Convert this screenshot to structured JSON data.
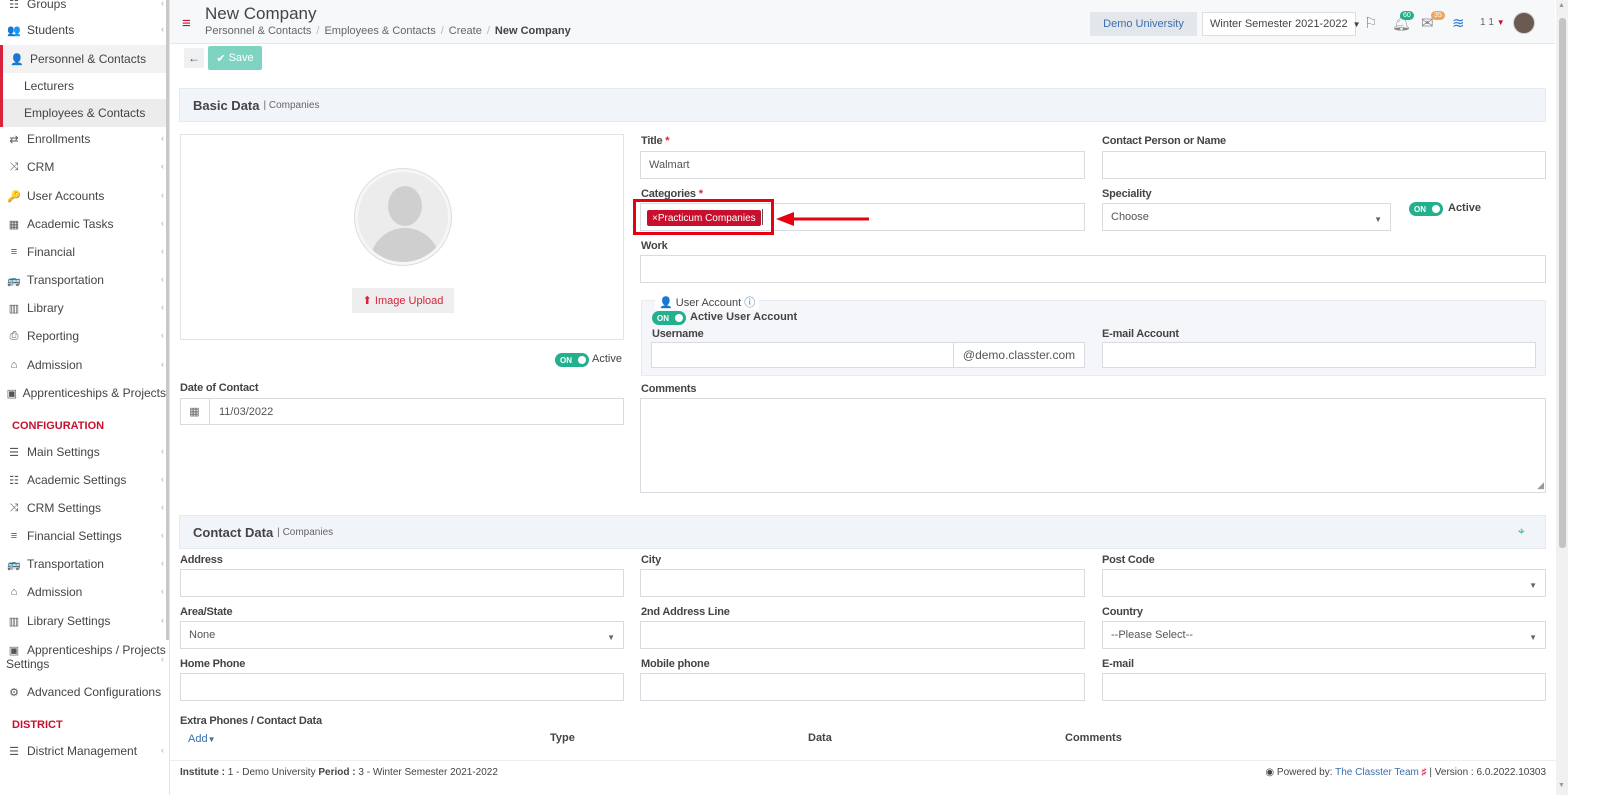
{
  "sidebar": {
    "items": [
      {
        "label": "Groups",
        "icon": "groups-icon",
        "glyph": "☷"
      },
      {
        "label": "Students",
        "icon": "students-icon",
        "glyph": "👥"
      },
      {
        "label": "Personnel & Contacts",
        "icon": "person-icon",
        "glyph": "👤"
      },
      {
        "label": "Lecturers"
      },
      {
        "label": "Employees & Contacts"
      },
      {
        "label": "Enrollments",
        "icon": "swap-icon",
        "glyph": "⇄"
      },
      {
        "label": "CRM",
        "icon": "shuffle-icon",
        "glyph": "⤨"
      },
      {
        "label": "User Accounts",
        "icon": "key-icon",
        "glyph": "🔑"
      },
      {
        "label": "Academic Tasks",
        "icon": "grid-icon",
        "glyph": "▦"
      },
      {
        "label": "Financial",
        "icon": "coins-icon",
        "glyph": "≡"
      },
      {
        "label": "Transportation",
        "icon": "bus-icon",
        "glyph": "🚌"
      },
      {
        "label": "Library",
        "icon": "books-icon",
        "glyph": "▥"
      },
      {
        "label": "Reporting",
        "icon": "print-icon",
        "glyph": "⎙"
      },
      {
        "label": "Admission",
        "icon": "bank-icon",
        "glyph": "⌂"
      },
      {
        "label": "Apprenticeships & Projects",
        "icon": "box-icon",
        "glyph": "▣"
      },
      {
        "label": "Main Settings",
        "icon": "sliders-icon",
        "glyph": "☰"
      },
      {
        "label": "Academic Settings",
        "icon": "groups-icon",
        "glyph": "☷"
      },
      {
        "label": "CRM Settings",
        "icon": "shuffle-icon",
        "glyph": "⤨"
      },
      {
        "label": "Financial Settings",
        "icon": "coins-icon",
        "glyph": "≡"
      },
      {
        "label": "Transportation",
        "icon": "bus-icon",
        "glyph": "🚌"
      },
      {
        "label": "Admission",
        "icon": "bank-icon",
        "glyph": "⌂"
      },
      {
        "label": "Library Settings",
        "icon": "books-icon",
        "glyph": "▥"
      },
      {
        "label": "Apprenticeships / Projects",
        "label2": "Settings",
        "icon": "box-icon",
        "glyph": "▣"
      },
      {
        "label": "Advanced Configurations",
        "icon": "gears-icon",
        "glyph": "⚙"
      },
      {
        "label": "District Management",
        "icon": "list-icon",
        "glyph": "☰"
      }
    ],
    "section_config": "CONFIGURATION",
    "section_district": "DISTRICT",
    "chevron": "‹"
  },
  "header": {
    "title": "New Company",
    "breadcrumb": [
      "Personnel & Contacts",
      "Employees & Contacts",
      "Create",
      "New Company"
    ],
    "breadcrumb_sep": "/",
    "institution": "Demo University",
    "semester": "Winter Semester 2021-2022",
    "notifications_count": "60",
    "messages_count": "35",
    "user_label": "1 1"
  },
  "actions": {
    "save_label": "Save",
    "back_glyph": "←",
    "save_glyph": "✔"
  },
  "basic_data": {
    "panel_title": "Basic Data",
    "panel_sub": "| Companies",
    "image_upload": "Image Upload",
    "active_label": "Active",
    "toggle_on": "ON",
    "date_of_contact_label": "Date of Contact",
    "date_of_contact_value": "11/03/2022",
    "title_label": "Title",
    "title_value": "Walmart",
    "required_mark": "*",
    "categories_label": "Categories",
    "category_chip": "Practicum Companies",
    "chip_remove": "×",
    "work_label": "Work",
    "contact_person_label": "Contact Person or Name",
    "speciality_label": "Speciality",
    "speciality_value": "Choose",
    "speciality_active": "Active",
    "user_account": {
      "legend": "User Account",
      "info_glyph": "ⓘ",
      "active_user_account": "Active User Account",
      "username_label": "Username",
      "domain": "@demo.classter.com",
      "email_account_label": "E-mail Account"
    },
    "comments_label": "Comments"
  },
  "contact_data": {
    "panel_title": "Contact Data",
    "panel_sub": "| Companies",
    "address_label": "Address",
    "city_label": "City",
    "post_code_label": "Post Code",
    "area_label": "Area/State",
    "area_value": "None",
    "address2_label": "2nd Address Line",
    "country_label": "Country",
    "country_value": "--Please Select--",
    "home_phone_label": "Home Phone",
    "mobile_phone_label": "Mobile phone",
    "email_label": "E-mail",
    "extra_phones_label": "Extra Phones / Contact Data",
    "add_label": "Add",
    "columns": [
      "Type",
      "Data",
      "Comments"
    ]
  },
  "footer": {
    "institute_label": "Institute :",
    "institute_value": "1 - Demo University",
    "period_label": "Period :",
    "period_value": "3 - Winter Semester 2021-2022",
    "powered_by": "Powered by:",
    "team": "The Classter Team",
    "version": "| Version : 6.0.2022.10303"
  },
  "colors": {
    "accent": "#c8102e",
    "toggle": "#23b08f",
    "save": "#7fd4c1",
    "highlight": "#e60012"
  }
}
